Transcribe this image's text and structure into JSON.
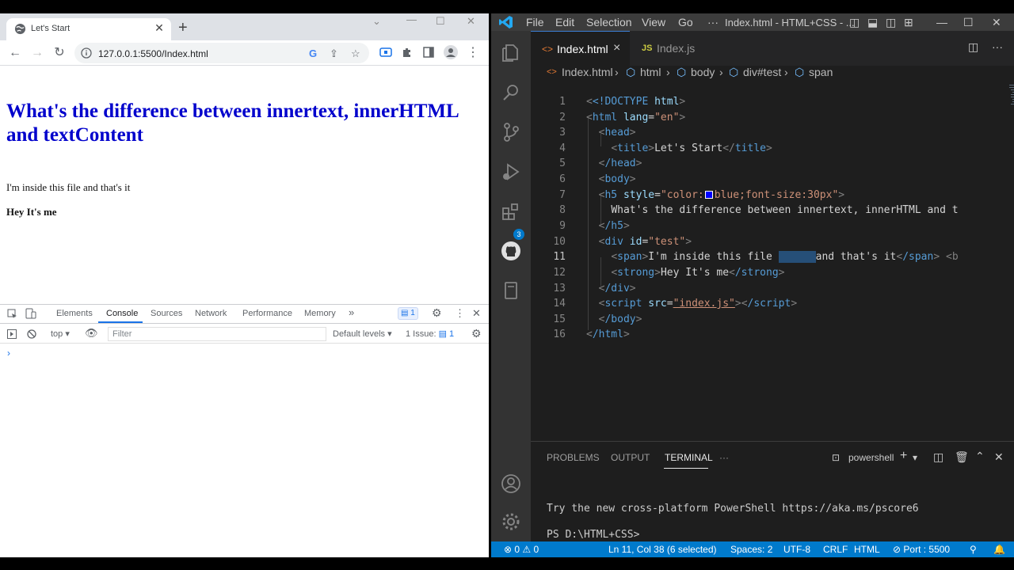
{
  "browser": {
    "tab_title": "Let's Start",
    "new_tab_symbol": "+",
    "url": "127.0.0.1:5500/Index.html",
    "page": {
      "heading": "What's the difference between innertext, innerHTML and textContent",
      "span_text": "I'm inside this file and that's it",
      "strong_text": "Hey It's me",
      "heading_color": "#0000cc"
    },
    "devtools": {
      "tabs": [
        "Elements",
        "Console",
        "Sources",
        "Network",
        "Performance",
        "Memory"
      ],
      "more_tabs": "»",
      "active_tab": "Console",
      "message_badge": "1",
      "context_select": "top",
      "filter_placeholder": "Filter",
      "levels_select": "Default levels",
      "issues_badge": "1 Issue:",
      "issues_count": "1",
      "prompt": "›"
    }
  },
  "vscode": {
    "menu": [
      "File",
      "Edit",
      "Selection",
      "View",
      "Go",
      "···"
    ],
    "window_title": "Index.html - HTML+CSS - ...",
    "tabs": [
      {
        "icon_text": "<>",
        "label": "Index.html"
      },
      {
        "icon_text": "JS",
        "label": "Index.js"
      }
    ],
    "tab_close": "×",
    "breadcrumb": [
      "Index.html",
      "html",
      "body",
      "div#test",
      "span"
    ],
    "line_numbers": [
      "1",
      "2",
      "3",
      "4",
      "5",
      "6",
      "7",
      "8",
      "9",
      "10",
      "11",
      "12",
      "13",
      "14",
      "15",
      "16"
    ],
    "code": {
      "l1_doctype": "<!DOCTYPE",
      "l1_html": " html",
      "l1_end": ">",
      "l2_open": "<",
      "l2_tag": "html",
      "l2_attr": " lang",
      "l2_eq": "=",
      "l2_val": "\"en\"",
      "l2_close": ">",
      "l3": "head",
      "l4_tag": "title",
      "l4_text": "Let's Start",
      "l5": "/head",
      "l6": "body",
      "l7_tag": "h5",
      "l7_attr": " style",
      "l7_val1": "\"color:",
      "l7_val2": "blue;font-size:30px\"",
      "l8_text": "What's the difference between innertext, innerHTML and t",
      "l9": "/h5",
      "l10_tag": "div",
      "l10_attr": " id",
      "l10_val": "\"test\"",
      "l11_tag": "span",
      "l11_text1": "I'm inside this file ",
      "l11_selected": "      ",
      "l11_text2": "and that's it",
      "l11_end_tag": "/span",
      "l11_trail": " <b",
      "l12_tag": "strong",
      "l12_text": "Hey It's me",
      "l12_end": "/strong",
      "l13": "/div",
      "l14_tag": "script",
      "l14_attr": " src",
      "l14_val": "\"index.js\"",
      "l14_end": "/script",
      "l15": "/body",
      "l16": "/html"
    },
    "panel": {
      "tabs": [
        "PROBLEMS",
        "OUTPUT",
        "TERMINAL",
        "···"
      ],
      "active_tab": "TERMINAL",
      "shell": "powershell",
      "line1": "Try the new cross-platform PowerShell https://aka.ms/pscore6",
      "line2": "PS D:\\HTML+CSS>"
    },
    "status": {
      "errors": "0",
      "warnings": "0",
      "position": "Ln 11, Col 38 (6 selected)",
      "spaces": "Spaces: 2",
      "encoding": "UTF-8",
      "eol": "CRLF",
      "language": "HTML",
      "port": "Port : 5500"
    },
    "accent_color": "#007acc"
  }
}
